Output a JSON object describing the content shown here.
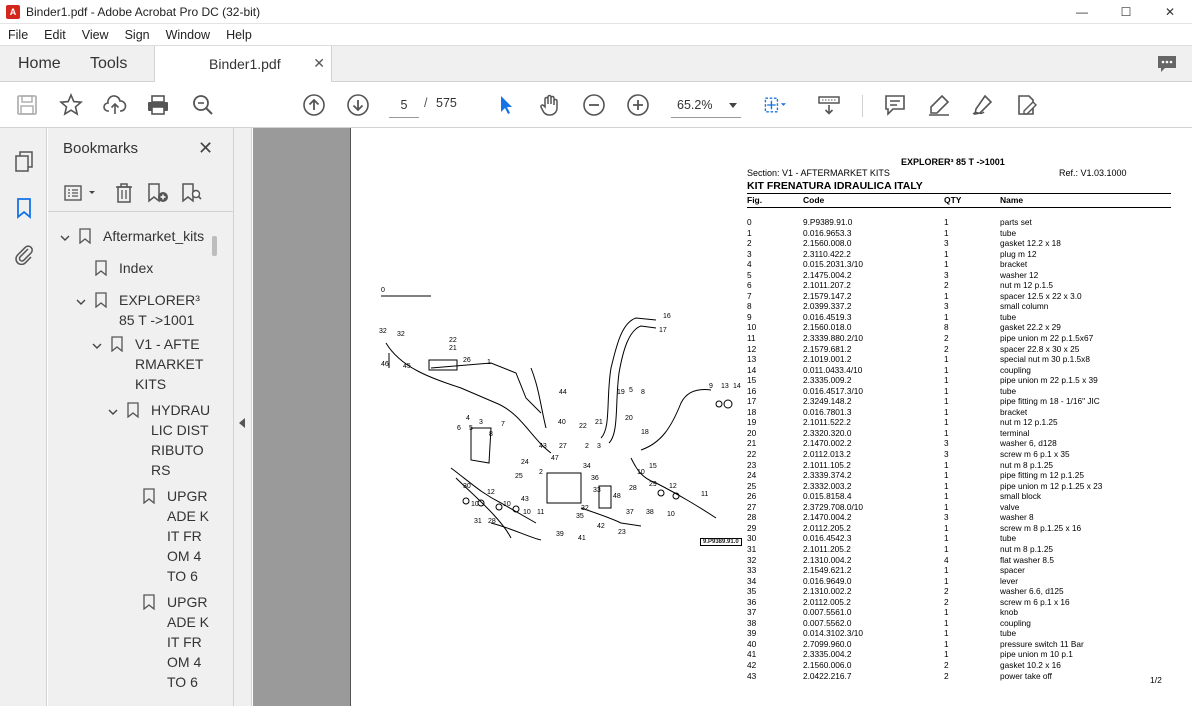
{
  "window": {
    "title": "Binder1.pdf - Adobe Acrobat Pro DC (32-bit)"
  },
  "menu": [
    "File",
    "Edit",
    "View",
    "Sign",
    "Window",
    "Help"
  ],
  "tabs": {
    "home": "Home",
    "tools": "Tools",
    "document": "Binder1.pdf"
  },
  "toolbar": {
    "current_page": "5",
    "page_separator": "/",
    "total_pages": "575",
    "zoom": "65.2%"
  },
  "bookmarks": {
    "title": "Bookmarks",
    "items": [
      {
        "label": "Aftermarket_kits"
      },
      {
        "label": "Index"
      },
      {
        "label": "EXPLORER³ 85 T ->1001"
      },
      {
        "label": "V1 - AFTERMARKET KITS"
      },
      {
        "label": "HYDRAULIC DISTRIBUTORS"
      },
      {
        "label": "UPGRADE KIT FROM 4 TO 6"
      },
      {
        "label": "UPGRADE KIT FROM 4 TO 6"
      }
    ]
  },
  "pdf_page": {
    "header": "EXPLORER³ 85 T ->1001",
    "section": "Section: V1 - AFTERMARKET KITS",
    "ref": "Ref.: V1.03.1000",
    "kit_title": "KIT FRENATURA IDRAULICA ITALY",
    "columns": [
      "Fig.",
      "Code",
      "QTY",
      "Name"
    ],
    "diagram_label": "9.P9389.91.0",
    "page_number": "1/2",
    "parts": [
      [
        "0",
        "9.P9389.91.0",
        "1",
        "parts set"
      ],
      [
        "1",
        "0.016.9653.3",
        "1",
        "tube"
      ],
      [
        "2",
        "2.1560.008.0",
        "3",
        "gasket 12.2 x 18"
      ],
      [
        "3",
        "2.3110.422.2",
        "1",
        "plug m 12"
      ],
      [
        "4",
        "0.015.2031.3/10",
        "1",
        "bracket"
      ],
      [
        "5",
        "2.1475.004.2",
        "3",
        "washer 12"
      ],
      [
        "6",
        "2.1011.207.2",
        "2",
        "nut m 12 p.1.5"
      ],
      [
        "7",
        "2.1579.147.2",
        "1",
        "spacer 12.5 x 22 x 3.0"
      ],
      [
        "8",
        "2.0399.337.2",
        "3",
        "small column"
      ],
      [
        "9",
        "0.016.4519.3",
        "1",
        "tube"
      ],
      [
        "10",
        "2.1560.018.0",
        "8",
        "gasket 22.2 x 29"
      ],
      [
        "11",
        "2.3339.880.2/10",
        "2",
        "pipe union m 22 p.1.5x67"
      ],
      [
        "12",
        "2.1579.681.2",
        "2",
        "spacer 22.8 x 30 x 25"
      ],
      [
        "13",
        "2.1019.001.2",
        "1",
        "special nut m 30 p.1.5x8"
      ],
      [
        "14",
        "0.011.0433.4/10",
        "1",
        "coupling"
      ],
      [
        "15",
        "2.3335.009.2",
        "1",
        "pipe union m 22 p.1.5 x 39"
      ],
      [
        "16",
        "0.016.4517.3/10",
        "1",
        "tube"
      ],
      [
        "17",
        "2.3249.148.2",
        "1",
        "pipe fitting m 18 - 1/16\" JIC"
      ],
      [
        "18",
        "0.016.7801.3",
        "1",
        "bracket"
      ],
      [
        "19",
        "2.1011.522.2",
        "1",
        "nut m 12 p.1.25"
      ],
      [
        "20",
        "2.3320.320.0",
        "1",
        "terminal"
      ],
      [
        "21",
        "2.1470.002.2",
        "3",
        "washer 6, d128"
      ],
      [
        "22",
        "2.0112.013.2",
        "3",
        "screw m 6 p.1 x 35"
      ],
      [
        "23",
        "2.1011.105.2",
        "1",
        "nut m 8 p.1.25"
      ],
      [
        "24",
        "2.3339.374.2",
        "1",
        "pipe fitting m 12 p.1.25"
      ],
      [
        "25",
        "2.3332.003.2",
        "1",
        "pipe union m 12 p.1.25 x 23"
      ],
      [
        "26",
        "0.015.8158.4",
        "1",
        "small block"
      ],
      [
        "27",
        "2.3729.708.0/10",
        "1",
        "valve"
      ],
      [
        "28",
        "2.1470.004.2",
        "3",
        "washer 8"
      ],
      [
        "29",
        "2.0112.205.2",
        "1",
        "screw m 8 p.1.25 x 16"
      ],
      [
        "30",
        "0.016.4542.3",
        "1",
        "tube"
      ],
      [
        "31",
        "2.1011.205.2",
        "1",
        "nut m 8 p.1.25"
      ],
      [
        "32",
        "2.1310.004.2",
        "4",
        "flat washer 8.5"
      ],
      [
        "33",
        "2.1549.621.2",
        "1",
        "spacer"
      ],
      [
        "34",
        "0.016.9649.0",
        "1",
        "lever"
      ],
      [
        "35",
        "2.1310.002.2",
        "2",
        "washer 6.6, d125"
      ],
      [
        "36",
        "2.0112.005.2",
        "2",
        "screw m 6 p.1 x 16"
      ],
      [
        "37",
        "0.007.5561.0",
        "1",
        "knob"
      ],
      [
        "38",
        "0.007.5562.0",
        "1",
        "coupling"
      ],
      [
        "39",
        "0.014.3102.3/10",
        "1",
        "tube"
      ],
      [
        "40",
        "2.7099.960.0",
        "1",
        "pressure switch 11 Bar"
      ],
      [
        "41",
        "2.3335.004.2",
        "1",
        "pipe union m 10 p.1"
      ],
      [
        "42",
        "2.1560.006.0",
        "2",
        "gasket 10.2 x 16"
      ],
      [
        "43",
        "2.0422.216.7",
        "2",
        "power take off"
      ]
    ]
  },
  "colors": {
    "accent_blue": "#1473e6",
    "acrobat_red": "#d4271c",
    "doc_gray": "#9a9a9a"
  }
}
